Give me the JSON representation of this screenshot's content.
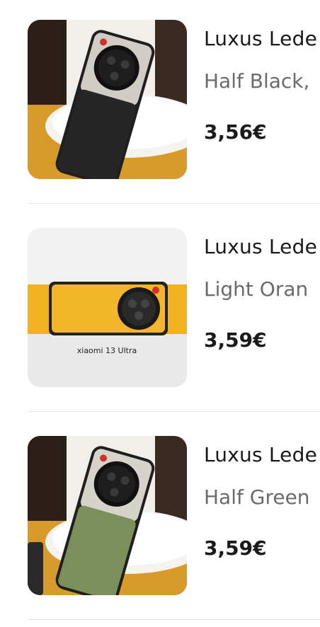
{
  "products": [
    {
      "title": "Luxus Lede",
      "variant": "Half Black,",
      "price": "3,56€",
      "image": "phone-case-half-black"
    },
    {
      "title": "Luxus Lede",
      "variant": "Light Oran",
      "price": "3,59€",
      "image": "phone-case-light-orange",
      "image_caption": "xiaomi 13 Ultra"
    },
    {
      "title": "Luxus Lede",
      "variant": "Half Green",
      "price": "3,59€",
      "image": "phone-case-half-green"
    }
  ],
  "colors": {
    "title": "#1a1a1a",
    "variant": "#6b6b6b",
    "divider": "#e6e6e6",
    "orange": "#f2b21f",
    "case_black": "#262626",
    "case_green": "#7b8f5a",
    "table_wood": "#d89a2a"
  }
}
